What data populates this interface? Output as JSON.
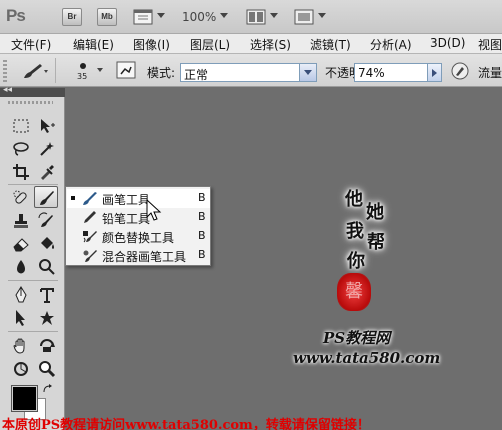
{
  "appbar": {
    "logo": "Ps",
    "br_button": "Br",
    "mb_button": "Mb",
    "zoom": "100%"
  },
  "menu": {
    "items": [
      "文件(F)",
      "编辑(E)",
      "图像(I)",
      "图层(L)",
      "选择(S)",
      "滤镜(T)",
      "分析(A)",
      "3D(D)",
      "视图"
    ]
  },
  "options": {
    "brush_size": "35",
    "mode_label": "模式:",
    "mode_value": "正常",
    "opacity_label": "不透明度:",
    "opacity_value": "74%",
    "flow_label": "流量"
  },
  "tools_panel": {
    "collapse_glyph": "◂◂"
  },
  "flyout": {
    "items": [
      {
        "label": "画笔工具",
        "key": "B"
      },
      {
        "label": "铅笔工具",
        "key": "B"
      },
      {
        "label": "颜色替换工具",
        "key": "B"
      },
      {
        "label": "混合器画笔工具",
        "key": "B"
      }
    ]
  },
  "canvas": {
    "poem": [
      "他",
      "她",
      "我",
      "帮",
      "你"
    ],
    "seal": "馨",
    "watermark_ps": "PS教程网",
    "watermark_url": "www.tata580.com",
    "bottom_notice": "本原创PS教程请访问www.tata580.com，转载请保留链接！"
  },
  "colors": {
    "canvas_bg": "#6e6e6e",
    "highlight": "#ffffff",
    "accent_blue": "#3a4f7a",
    "watermark_red": "#e00000"
  }
}
